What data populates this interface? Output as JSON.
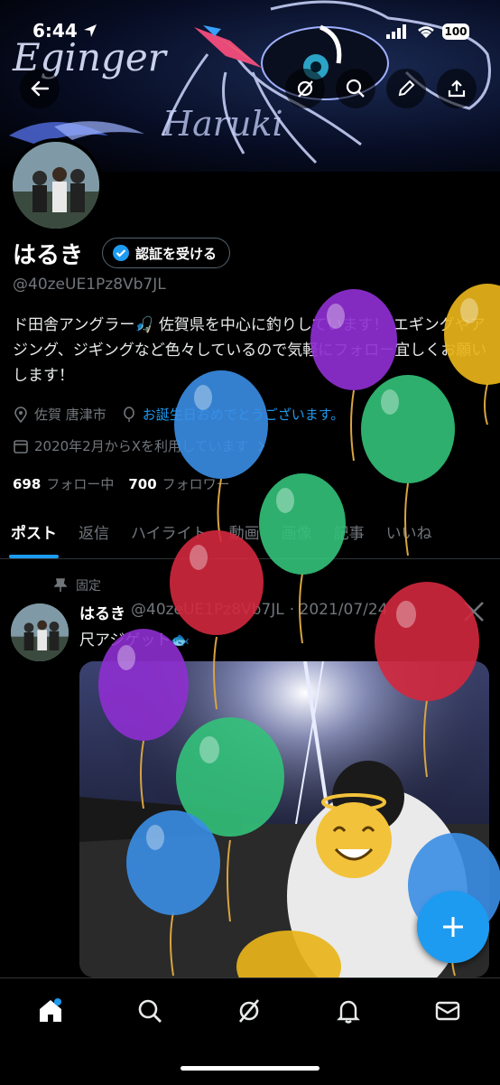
{
  "status_bar": {
    "time": "6:44",
    "battery": "100"
  },
  "banner": {
    "line1": "Eginger",
    "line2": "Haruki"
  },
  "profile": {
    "name": "はるき",
    "verify_label": "認証を受ける",
    "handle": "@40zeUE1Pz8Vb7JL",
    "bio": "ド田舎アングラー🎣 佐賀県を中心に釣りしています！ エギングやアジング、ジギングなど色々しているので気軽にフォロー宜しくお願いします！",
    "location": "佐賀 唐津市",
    "birthday_text": "お誕生日おめでとうございます。",
    "joined": "2020年2月からXを利用しています",
    "following_count": "698",
    "following_label": "フォロー中",
    "followers_count": "700",
    "followers_label": "フォロワー"
  },
  "tabs": [
    "ポスト",
    "返信",
    "ハイライト",
    "動画",
    "画像",
    "記事",
    "いいね"
  ],
  "post": {
    "pinned_label": "固定",
    "name": "はるき",
    "handle": "@40zeUE1Pz8Vb7JL",
    "date": "· 2021/07/24",
    "text": "尺アジゲット🐟"
  },
  "fab_label": "+",
  "colors": {
    "accent": "#1d9bf0",
    "balloon_purple": "#8e2fd0",
    "balloon_gold": "#e8b41a",
    "balloon_blue": "#3a8ee6",
    "balloon_green": "#33c27a",
    "balloon_red": "#d3283e"
  },
  "icons": [
    "back-arrow-icon",
    "grok-icon",
    "search-icon",
    "edit-icon",
    "share-icon",
    "verified-badge-icon",
    "location-icon",
    "balloon-icon",
    "calendar-icon",
    "chevron-right-icon",
    "pin-icon",
    "x-logo-icon",
    "home-icon",
    "search-nav-icon",
    "grok-nav-icon",
    "bell-icon",
    "mail-icon"
  ]
}
